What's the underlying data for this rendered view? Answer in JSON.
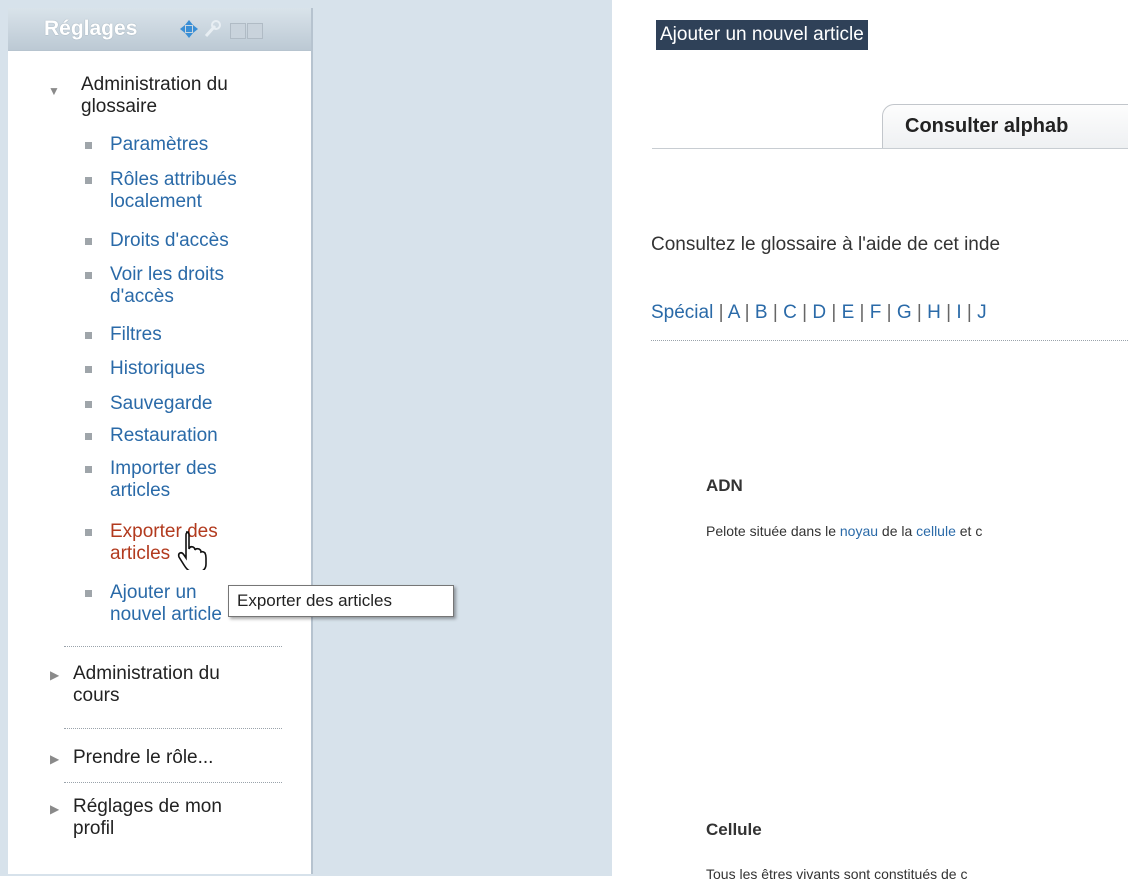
{
  "settings_block": {
    "title": "Réglages",
    "icons": [
      "move-icon",
      "wrench-icon",
      "hide-icon",
      "dock-icon"
    ],
    "glossary_admin": {
      "label_line1": "Administration du",
      "label_line2": "glossaire",
      "items": [
        {
          "line1": "Paramètres",
          "line2": ""
        },
        {
          "line1": "Rôles attribués",
          "line2": "localement"
        },
        {
          "line1": "Droits d'accès",
          "line2": ""
        },
        {
          "line1": "Voir les droits",
          "line2": "d'accès"
        },
        {
          "line1": "Filtres",
          "line2": ""
        },
        {
          "line1": "Historiques",
          "line2": ""
        },
        {
          "line1": "Sauvegarde",
          "line2": ""
        },
        {
          "line1": "Restauration",
          "line2": ""
        },
        {
          "line1": "Importer des",
          "line2": "articles"
        },
        {
          "line1": "Exporter des",
          "line2": "articles"
        },
        {
          "line1": "Ajouter un",
          "line2": "nouvel article"
        }
      ]
    },
    "course_admin": {
      "line1": "Administration du",
      "line2": "cours"
    },
    "switch_role": {
      "line1": "Prendre le rôle...",
      "line2": ""
    },
    "profile_settings": {
      "line1": "Réglages de mon",
      "line2": "profil"
    }
  },
  "tooltip": {
    "text": "Exporter des articles"
  },
  "main": {
    "add_entry": "Ajouter un nouvel article",
    "tab": "Consulter alphab",
    "intro": "Consultez le glossaire à l'aide de cet inde",
    "alphabet": [
      "Spécial",
      "A",
      "B",
      "C",
      "D",
      "E",
      "F",
      "G",
      "H",
      "I",
      "J"
    ],
    "entries": [
      {
        "title": "ADN",
        "text_before": "Pelote située dans le ",
        "link1": "noyau",
        "text_mid": " de la ",
        "link2": "cellule",
        "text_after": " et c"
      },
      {
        "title": "Cellule",
        "text": "Tous les êtres vivants sont constitués de c"
      }
    ]
  },
  "colors": {
    "link": "#2a6aa8",
    "active_link": "#b23a1e",
    "sidebar_bg": "#d7e2eb",
    "highlight_bg": "#2f4158"
  }
}
